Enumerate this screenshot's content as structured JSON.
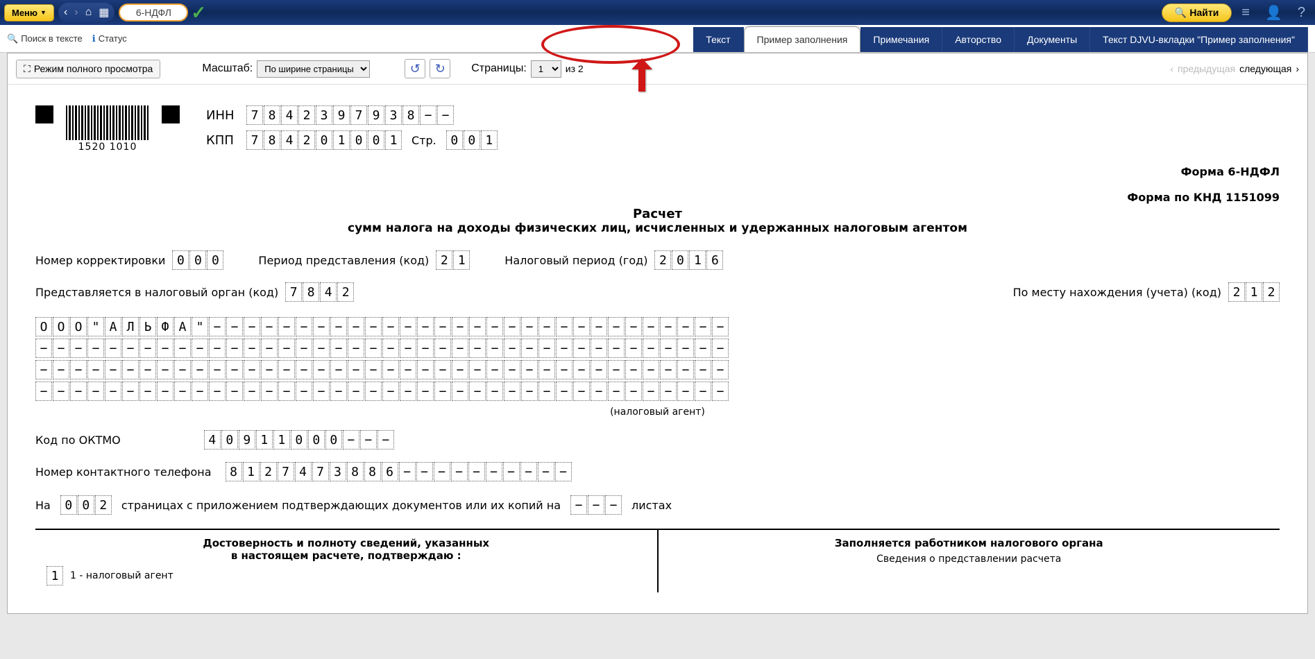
{
  "topbar": {
    "menu": "Меню",
    "search_pill": "6-НДФЛ",
    "find": "Найти"
  },
  "secbar": {
    "search_text": "Поиск в тексте",
    "status": "Статус"
  },
  "tabs": {
    "text": "Текст",
    "example": "Пример заполнения",
    "notes": "Примечания",
    "author": "Авторство",
    "docs": "Документы",
    "djvu": "Текст DJVU-вкладки \"Пример заполнения\""
  },
  "viewer": {
    "fullview": "Режим полного просмотра",
    "zoom_label": "Масштаб:",
    "zoom_value": "По ширине страницы",
    "pages_label": "Страницы:",
    "page_current": "1",
    "page_of": "из 2",
    "prev": "предыдущая",
    "next": "следующая"
  },
  "doc": {
    "barcode": "1520 1010",
    "inn_label": "ИНН",
    "inn": [
      "7",
      "8",
      "4",
      "2",
      "3",
      "9",
      "7",
      "9",
      "3",
      "8",
      "−",
      "−"
    ],
    "kpp_label": "КПП",
    "kpp": [
      "7",
      "8",
      "4",
      "2",
      "0",
      "1",
      "0",
      "0",
      "1"
    ],
    "page_label": "Стр.",
    "page": [
      "0",
      "0",
      "1"
    ],
    "form_name": "Форма 6-НДФЛ",
    "form_knd": "Форма по КНД 1151099",
    "title": "Расчет",
    "subtitle": "сумм налога на доходы физических лиц, исчисленных и удержанных налоговым агентом",
    "corr_label": "Номер корректировки",
    "corr": [
      "0",
      "0",
      "0"
    ],
    "period_label": "Период представления (код)",
    "period": [
      "2",
      "1"
    ],
    "year_label": "Налоговый период (год)",
    "year": [
      "2",
      "0",
      "1",
      "6"
    ],
    "organ_label": "Представляется в налоговый орган (код)",
    "organ": [
      "7",
      "8",
      "4",
      "2"
    ],
    "place_label": "По месту нахождения (учета) (код)",
    "place": [
      "2",
      "1",
      "2"
    ],
    "name_cells": [
      "О",
      "О",
      "О",
      "\"",
      "А",
      "Л",
      "Ь",
      "Ф",
      "А",
      "\"",
      "−",
      "−",
      "−",
      "−",
      "−",
      "−",
      "−",
      "−",
      "−",
      "−",
      "−",
      "−",
      "−",
      "−",
      "−",
      "−",
      "−",
      "−",
      "−",
      "−",
      "−",
      "−",
      "−",
      "−",
      "−",
      "−",
      "−",
      "−",
      "−",
      "−"
    ],
    "agent_note": "(налоговый агент)",
    "oktmo_label": "Код по ОКТМО",
    "oktmo": [
      "4",
      "0",
      "9",
      "1",
      "1",
      "0",
      "0",
      "0",
      "−",
      "−",
      "−"
    ],
    "phone_label": "Номер контактного телефона",
    "phone": [
      "8",
      "1",
      "2",
      "7",
      "4",
      "7",
      "3",
      "8",
      "8",
      "6",
      "−",
      "−",
      "−",
      "−",
      "−",
      "−",
      "−",
      "−",
      "−",
      "−"
    ],
    "on_label": "На",
    "pages_cnt": [
      "0",
      "0",
      "2"
    ],
    "pages_text": "страницах с приложением подтверждающих документов или их копий на",
    "copies": [
      "−",
      "−",
      "−"
    ],
    "sheets": "листах",
    "bottom_left_title1": "Достоверность и полноту сведений, указанных",
    "bottom_left_title2": "в настоящем расчете, подтверждаю :",
    "confirm_code": [
      "1"
    ],
    "confirm_text": "1 - налоговый агент",
    "bottom_right_title": "Заполняется работником налогового органа",
    "bottom_right_sub": "Сведения о представлении расчета"
  }
}
